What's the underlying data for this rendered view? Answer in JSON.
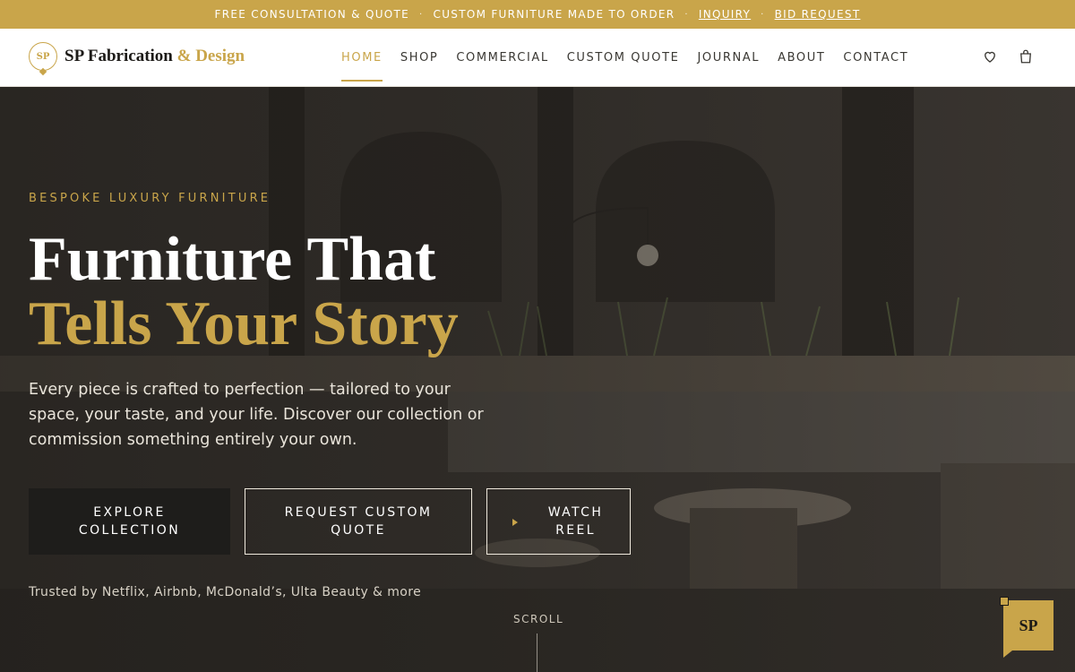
{
  "announcement": {
    "items": [
      "FREE CONSULTATION & QUOTE",
      "CUSTOM FURNITURE MADE TO ORDER"
    ],
    "separator": "·",
    "links": [
      "INQUIRY",
      "BID REQUEST"
    ]
  },
  "logo": {
    "mark": "SP",
    "name": "SP Fabrication",
    "accent": "& Design"
  },
  "nav": {
    "items": [
      {
        "label": "HOME",
        "active": true
      },
      {
        "label": "SHOP"
      },
      {
        "label": "COMMERCIAL"
      },
      {
        "label": "CUSTOM QUOTE"
      },
      {
        "label": "JOURNAL"
      },
      {
        "label": "ABOUT"
      },
      {
        "label": "CONTACT"
      }
    ]
  },
  "header_icons": [
    "heart-icon",
    "shopping-bag-icon"
  ],
  "hero": {
    "eyebrow": "BESPOKE LUXURY FURNITURE",
    "title_line1": "Furniture That",
    "title_line2": "Tells Your Story",
    "description": "Every piece is crafted to perfection — tailored to your space, your taste, and your life. Discover our collection or commission something entirely your own.",
    "buttons": {
      "explore": "EXPLORE COLLECTION",
      "quote": "REQUEST CUSTOM QUOTE",
      "reel": "WATCH REEL"
    },
    "trusted": "Trusted by Netflix, Airbnb, McDonald’s, Ulta Beauty & more",
    "scroll": "SCROLL"
  },
  "badge": {
    "text": "SP"
  },
  "colors": {
    "accent": "#c9a54a",
    "dark": "#1c1a17",
    "white": "#ffffff"
  }
}
